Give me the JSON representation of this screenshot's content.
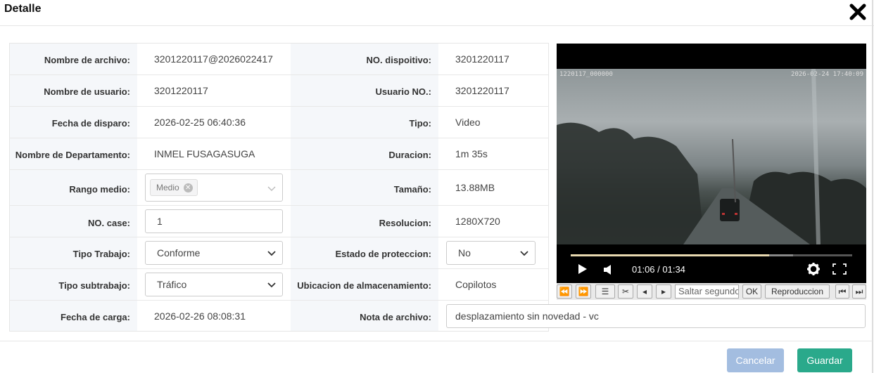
{
  "dialog": {
    "title": "Detalle",
    "close_icon": "close-icon"
  },
  "left": [
    {
      "label": "Nombre de archivo:",
      "value": "3201220117@2026022417"
    },
    {
      "label": "Nombre de usuario:",
      "value": "3201220117"
    },
    {
      "label": "Fecha de disparo:",
      "value": "2026-02-25 06:40:36"
    },
    {
      "label": "Nombre de Departamento:",
      "value": "INMEL FUSAGASUGA"
    },
    {
      "label": "Rango medio:",
      "tag": "Medio"
    },
    {
      "label": "NO. case:",
      "value": "1"
    },
    {
      "label": "Tipo Trabajo:",
      "value": "Conforme"
    },
    {
      "label": "Tipo subtrabajo:",
      "value": "Tráfico"
    },
    {
      "label": "Fecha de carga:",
      "value": "2026-02-26 08:08:31"
    }
  ],
  "right": [
    {
      "label": "NO. dispoitivo:",
      "value": "3201220117"
    },
    {
      "label": "Usuario NO.:",
      "value": "3201220117"
    },
    {
      "label": "Tipo:",
      "value": "Video"
    },
    {
      "label": "Duracion:",
      "value": "1m 35s"
    },
    {
      "label": "Tamaño:",
      "value": "13.88MB"
    },
    {
      "label": "Resolucion:",
      "value": "1280X720"
    },
    {
      "label": "Estado de proteccion:",
      "value": "No"
    },
    {
      "label": "Ubicacion de almacenamiento:",
      "value": "Copilotos"
    },
    {
      "label": "Nota de archivo:",
      "value": "desplazamiento sin novedad - vc"
    }
  ],
  "video": {
    "overlay_left": "1220117_000000",
    "overlay_right": "2026-02-24 17:40:09",
    "time": "01:06 / 01:34",
    "progress": 0.705,
    "buffered": 0.79
  },
  "toolbar": {
    "seek_placeholder": "Saltar segundos",
    "ok_label": "OK",
    "playback_label": "Reproduccion"
  },
  "footer": {
    "cancel_label": "Cancelar",
    "save_label": "Guardar"
  },
  "colors": {
    "cancel": "#a3bde0",
    "save": "#2aa98b",
    "label_bg": "#f5f7fa"
  }
}
